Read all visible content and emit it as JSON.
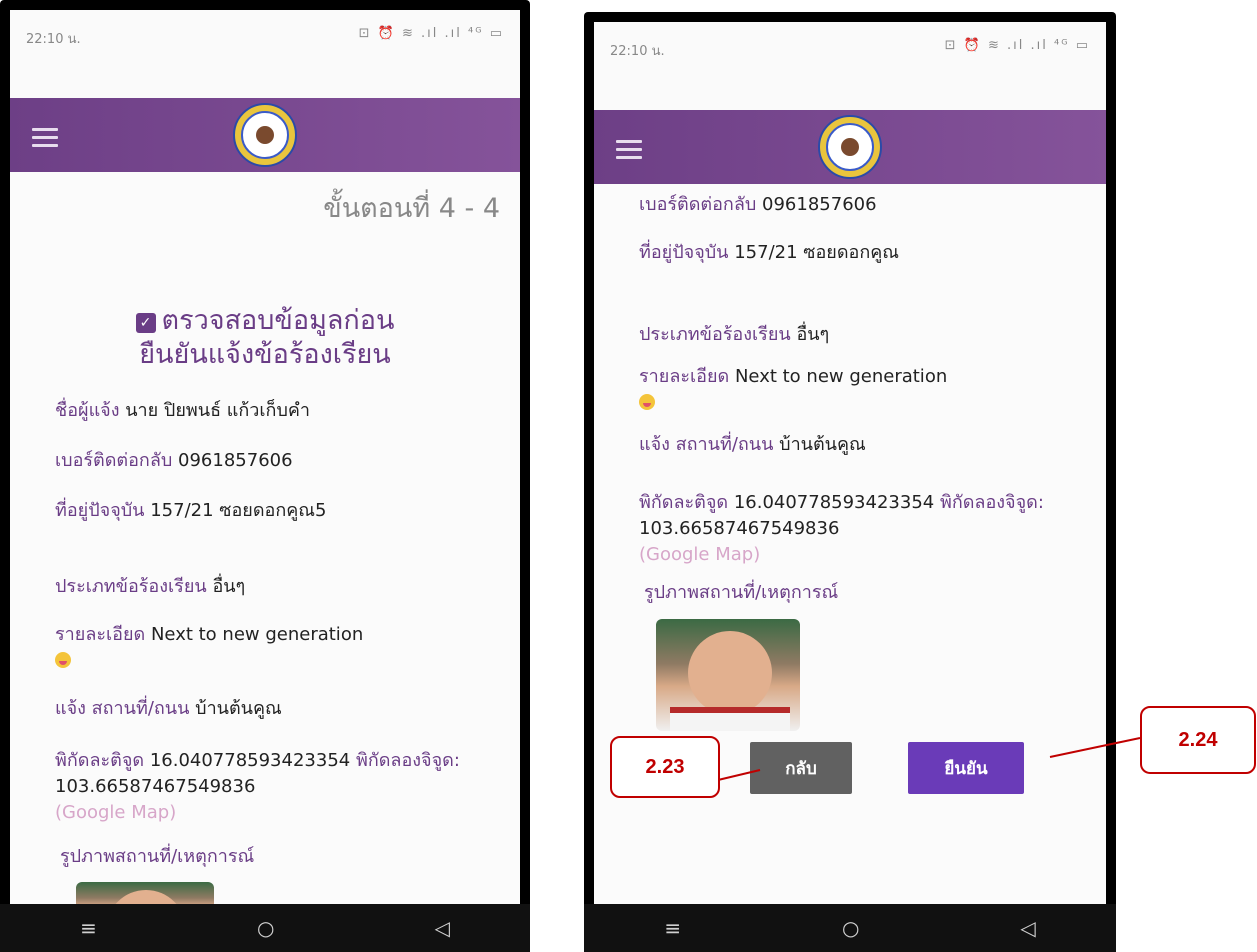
{
  "left_phone": {
    "status": {
      "time": "22:10 น.",
      "icons": "⊡ ⏰ ≋ .ıl .ıl ⁴ᴳ ▭"
    },
    "step_title": "ขั้นตอนที่ 4 - 4",
    "heading": "ตรวจสอบข้อมูลก่อน\nยืนยันแจ้งข้อร้องเรียน",
    "fields": [
      {
        "label": "ชื่อผู้แจ้ง",
        "value": "นาย ปิยพนธ์ แก้วเก็บคำ"
      },
      {
        "label": "เบอร์ติดต่อกลับ",
        "value": "0961857606"
      },
      {
        "label": "ที่อยู่ปัจจุบัน",
        "value": "157/21 ซอยดอกคูณ5"
      },
      {
        "label": "ประเภทข้อร้องเรียน",
        "value": "อื่นๆ"
      },
      {
        "label": "รายละเอียด",
        "value": "Next to new generation"
      },
      {
        "label": "แจ้ง สถานที่/ถนน",
        "value": "บ้านต้นคูณ"
      },
      {
        "label": "พิกัดละติจูด",
        "value": "16.040778593423354",
        "label2": "พิกัดลองจิจูด:",
        "value2": "103.66587467549836",
        "link": "(Google Map)"
      },
      {
        "label": "รูปภาพสถานที่/เหตุการณ์"
      }
    ]
  },
  "right_phone": {
    "status": {
      "time": "22:10 น.",
      "icons": "⊡ ⏰ ≋ .ıl .ıl ⁴ᴳ ▭"
    },
    "fields": [
      {
        "label": "เบอร์ติดต่อกลับ",
        "value": "0961857606"
      },
      {
        "label": "ที่อยู่ปัจจุบัน",
        "value": "157/21 ซอยดอกคูณ"
      },
      {
        "label": "ประเภทข้อร้องเรียน",
        "value": "อื่นๆ"
      },
      {
        "label": "รายละเอียด",
        "value": "Next to new generation"
      },
      {
        "label": "แจ้ง สถานที่/ถนน",
        "value": "บ้านต้นคูณ"
      },
      {
        "label": "พิกัดละติจูด",
        "value": "16.040778593423354",
        "label2": "พิกัดลองจิจูด:",
        "value2": "103.66587467549836",
        "link": "(Google Map)"
      },
      {
        "label": "รูปภาพสถานที่/เหตุการณ์"
      }
    ],
    "back_button": "กลับ",
    "confirm_button": "ยืนยัน"
  },
  "nav_icons": {
    "menu": "≡",
    "home": "○",
    "back": "◁"
  },
  "callouts": {
    "back": "2.23",
    "confirm": "2.24"
  },
  "colors": {
    "primary": "#6a3d86",
    "back_button": "#616161",
    "confirm_button": "#6a3bb8",
    "callout": "#c00000"
  }
}
